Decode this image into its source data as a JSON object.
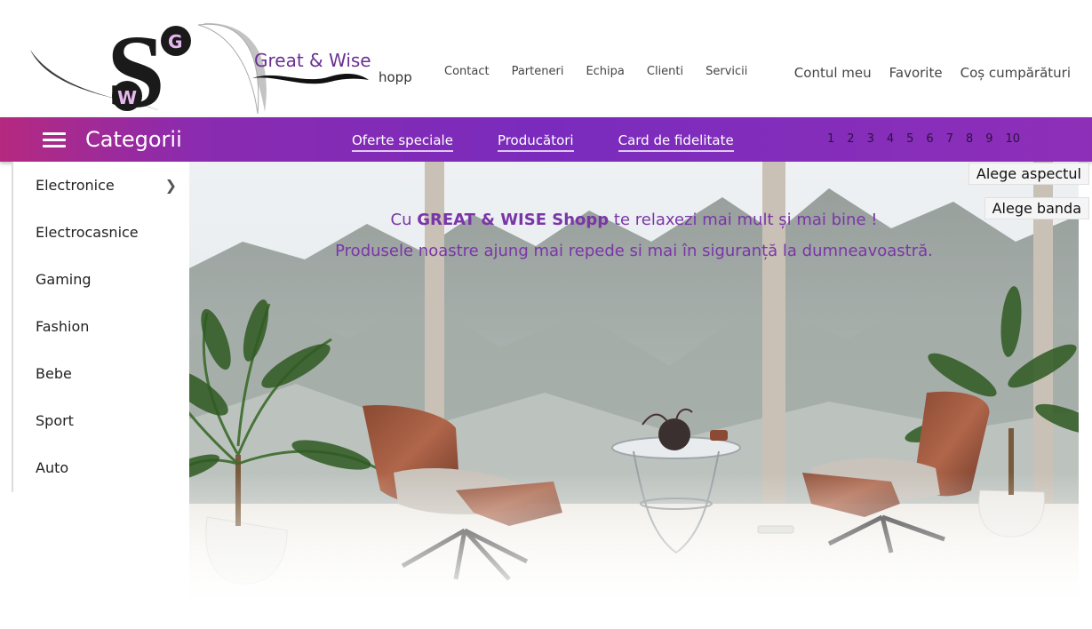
{
  "brand": {
    "logo_letters": [
      "S",
      "G",
      "W"
    ],
    "name": "Great & Wise",
    "suffix": "hopp"
  },
  "top_nav": [
    "Contact",
    "Parteneri",
    "Echipa",
    "Clienti",
    "Servicii"
  ],
  "account_nav": [
    "Contul meu",
    "Favorite",
    "Coș cumpărături"
  ],
  "category_bar": {
    "title": "Categorii",
    "links": [
      "Oferte speciale",
      "Producători",
      "Card de fidelitate"
    ],
    "pages": [
      "1",
      "2",
      "3",
      "4",
      "5",
      "6",
      "7",
      "8",
      "9",
      "10"
    ]
  },
  "sidebar": {
    "items": [
      "Electronice",
      "Electrocasnice",
      "Gaming",
      "Fashion",
      "Bebe",
      "Sport",
      "Auto"
    ],
    "expand_glyph": "❯"
  },
  "hero": {
    "line1_prefix": "Cu ",
    "line1_brand": "GREAT & WISE Shopp",
    "line1_suffix": " te relaxezi mai mult și mai bine !",
    "line2": "Produsele noastre ajung mai repede si mai în siguranță la dumneavoastră."
  },
  "side_tabs": [
    "Alege aspectul",
    "Alege banda"
  ],
  "colors": {
    "accent": "#7a2bbd",
    "accent_pink": "#b5297f",
    "hero_text": "#7a35a8"
  },
  "icons": {
    "menu": "hamburger-menu-icon",
    "chevron": "chevron-right-icon"
  }
}
